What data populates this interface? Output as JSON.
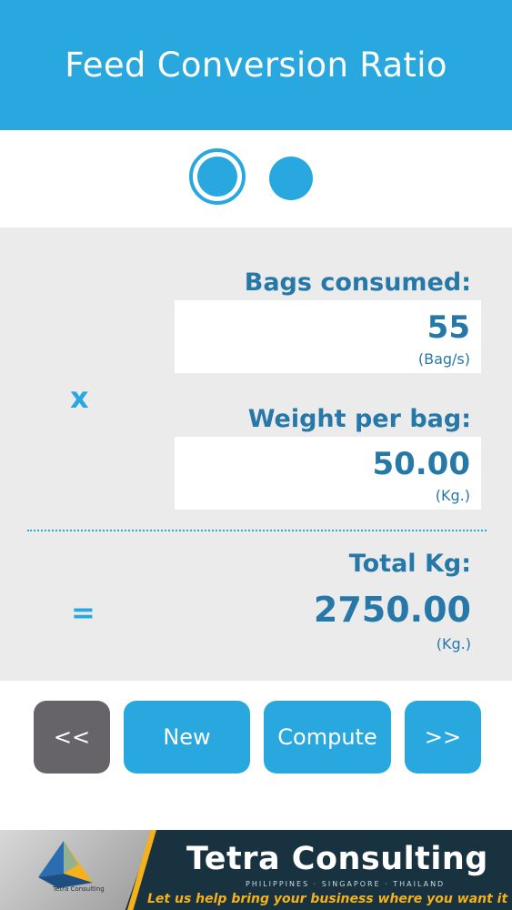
{
  "header": {
    "title": "Feed Conversion Ratio"
  },
  "pager": {
    "pages": 2,
    "current": 1
  },
  "calc": {
    "bags_label": "Bags consumed:",
    "bags_value": "55",
    "bags_unit": "(Bag/s)",
    "multiply_symbol": "x",
    "weight_label": "Weight per bag:",
    "weight_value": "50.00",
    "weight_unit": "(Kg.)",
    "equals_symbol": "=",
    "total_label": "Total Kg:",
    "total_value": "2750.00",
    "total_unit": "(Kg.)"
  },
  "buttons": {
    "prev_label": "<<",
    "new_label": "New",
    "compute_label": "Compute",
    "next_label": ">>"
  },
  "banner": {
    "brand": "Tetra Consulting",
    "countries": "PHILIPPINES · SINGAPORE · THAILAND",
    "tagline": "Let us  help bring your business where you want it to be...",
    "logo_text": "Tetra Consulting"
  },
  "colors": {
    "accent": "#29a8e0",
    "text_blue": "#2678a8",
    "panel": "#ebebeb",
    "button_dark": "#666469",
    "banner_bg": "#18323f",
    "banner_gold": "#f4b11c"
  }
}
